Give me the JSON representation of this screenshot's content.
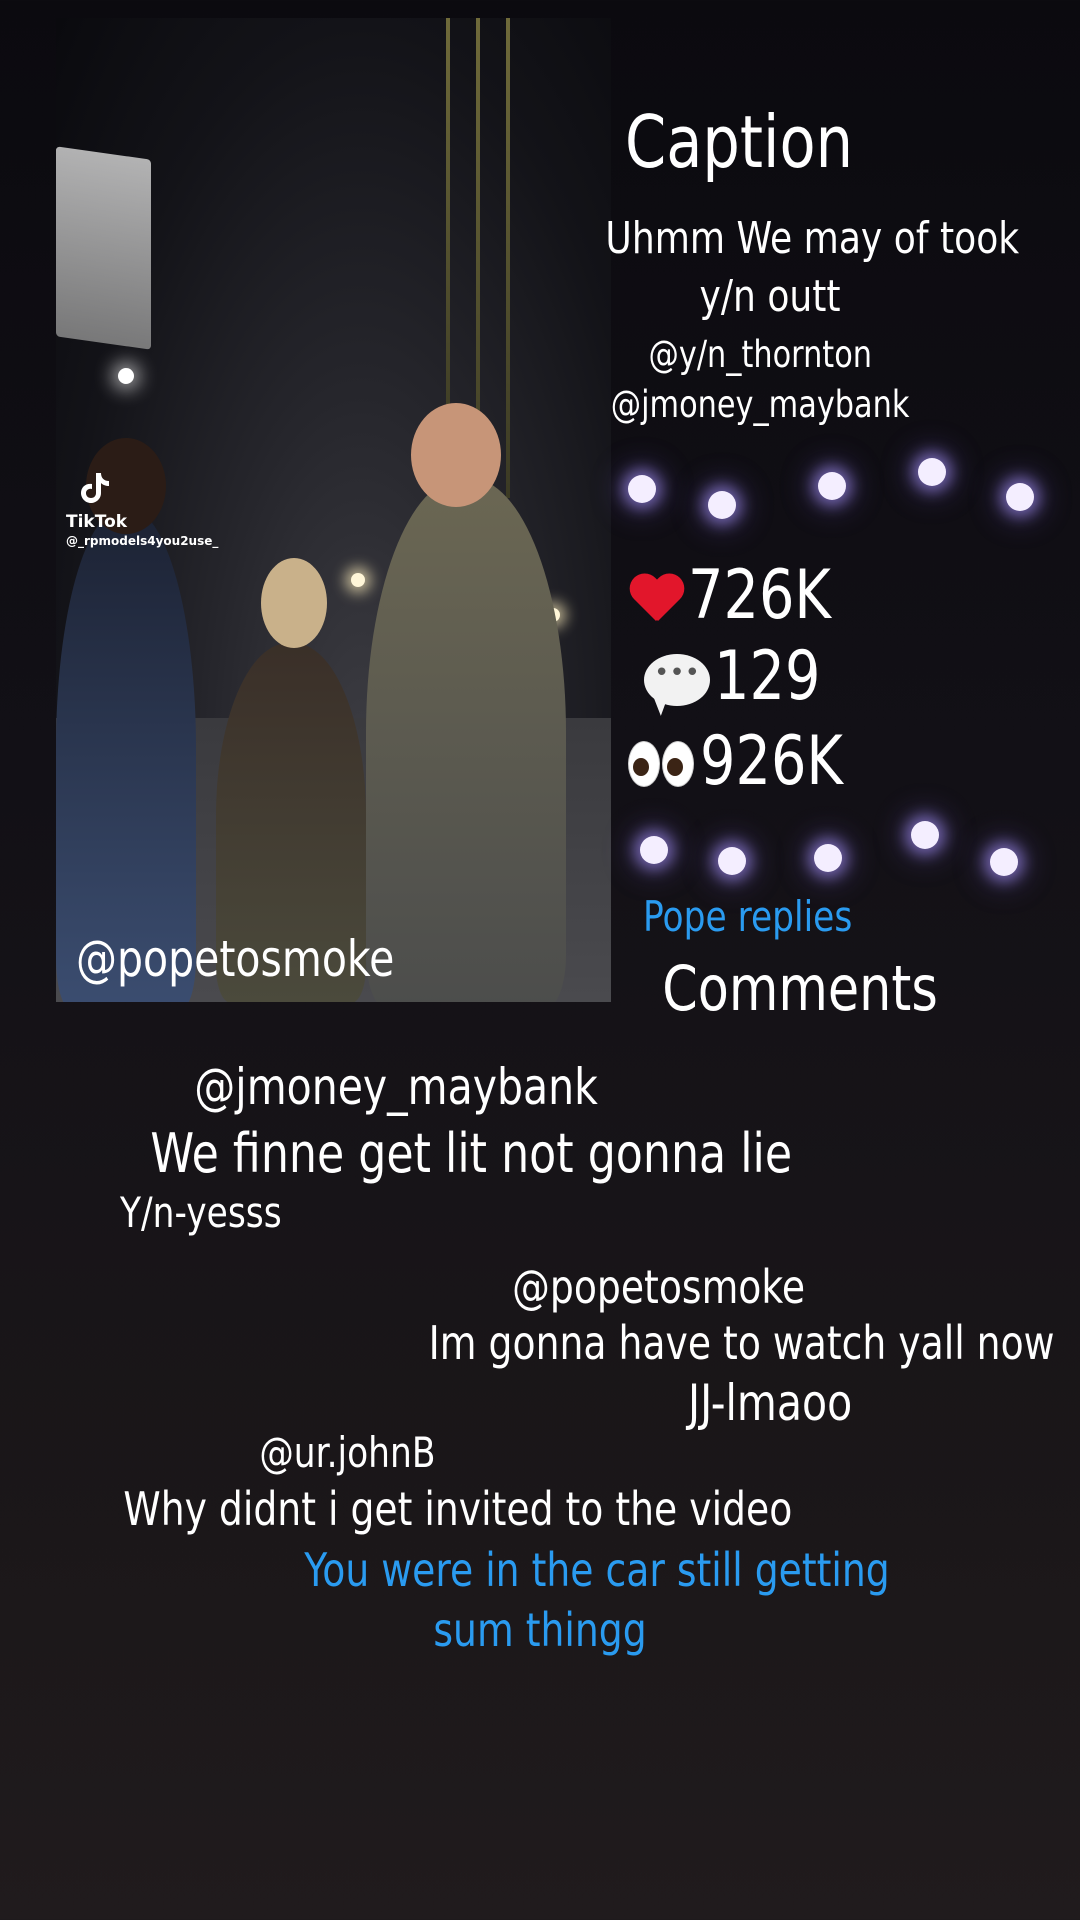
{
  "video": {
    "watermark_brand": "TikTok",
    "watermark_handle": "@_rpmodels4you2use_",
    "tag": "@popetosmoke"
  },
  "caption": {
    "title": "Caption",
    "text_line1": "Uhmm We may of took",
    "text_line2": "y/n outt",
    "mention1": "@y/n_thornton",
    "mention2": "@jmoney_maybank"
  },
  "stats": {
    "likes": "726K",
    "comments": "129",
    "views": "926K",
    "likes_icon": "red-heart-icon",
    "comments_icon": "speech-bubble-icon",
    "views_icon": "eyes-icon"
  },
  "replies_label": "Pope replies",
  "comments_title": "Comments",
  "comments": [
    {
      "handle": "@jmoney_maybank",
      "text": "We finne get lit not gonna lie",
      "reply": "Y/n-yesss"
    },
    {
      "handle": "@popetosmoke",
      "text": "Im gonna have to watch yall now",
      "reply": "JJ-lmaoo"
    },
    {
      "handle": "@ur.johnB",
      "text": "Why didnt i get invited to the video",
      "reply_line1": "You were in the car still getting",
      "reply_line2": "sum thingg"
    }
  ],
  "colors": {
    "accent_blue": "#2a9bf0",
    "glow_dot": "#f4eeff",
    "heart_red": "#e2162b"
  }
}
